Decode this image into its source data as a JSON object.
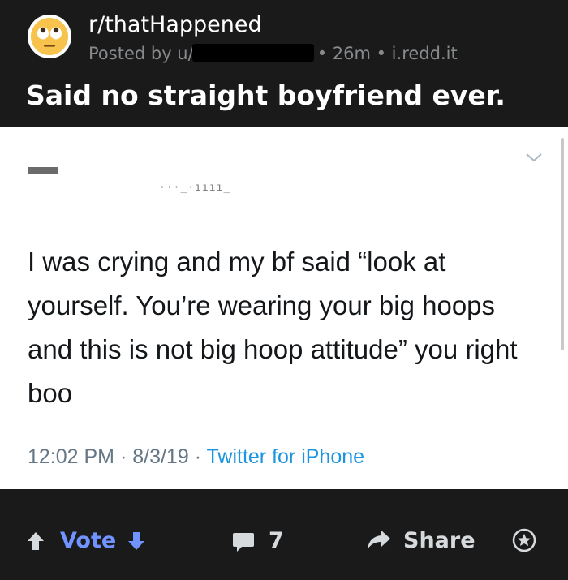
{
  "post": {
    "subreddit": "r/thatHappened",
    "posted_by_prefix": "Posted by u/",
    "age": "• 26m",
    "domain": "• i.redd.it",
    "title": "Said no straight boyfriend ever.",
    "avatar_icon": "rolling-eyes-emoji-icon"
  },
  "tweet": {
    "text": "I was crying and my bf said “look at yourself. You’re wearing your big hoops and this is not big hoop attitude” you right boo",
    "time": "12:02 PM",
    "date": "8/3/19",
    "separator": " · ",
    "source": "Twitter for iPhone",
    "menu_icon": "chevron-down-icon"
  },
  "actions": {
    "vote_label": "Vote",
    "comment_count": "7",
    "share_label": "Share",
    "icons": [
      "upvote-arrow-icon",
      "downvote-arrow-icon",
      "comment-icon",
      "share-arrow-icon",
      "award-icon"
    ],
    "vote_color": "#7193ff"
  }
}
